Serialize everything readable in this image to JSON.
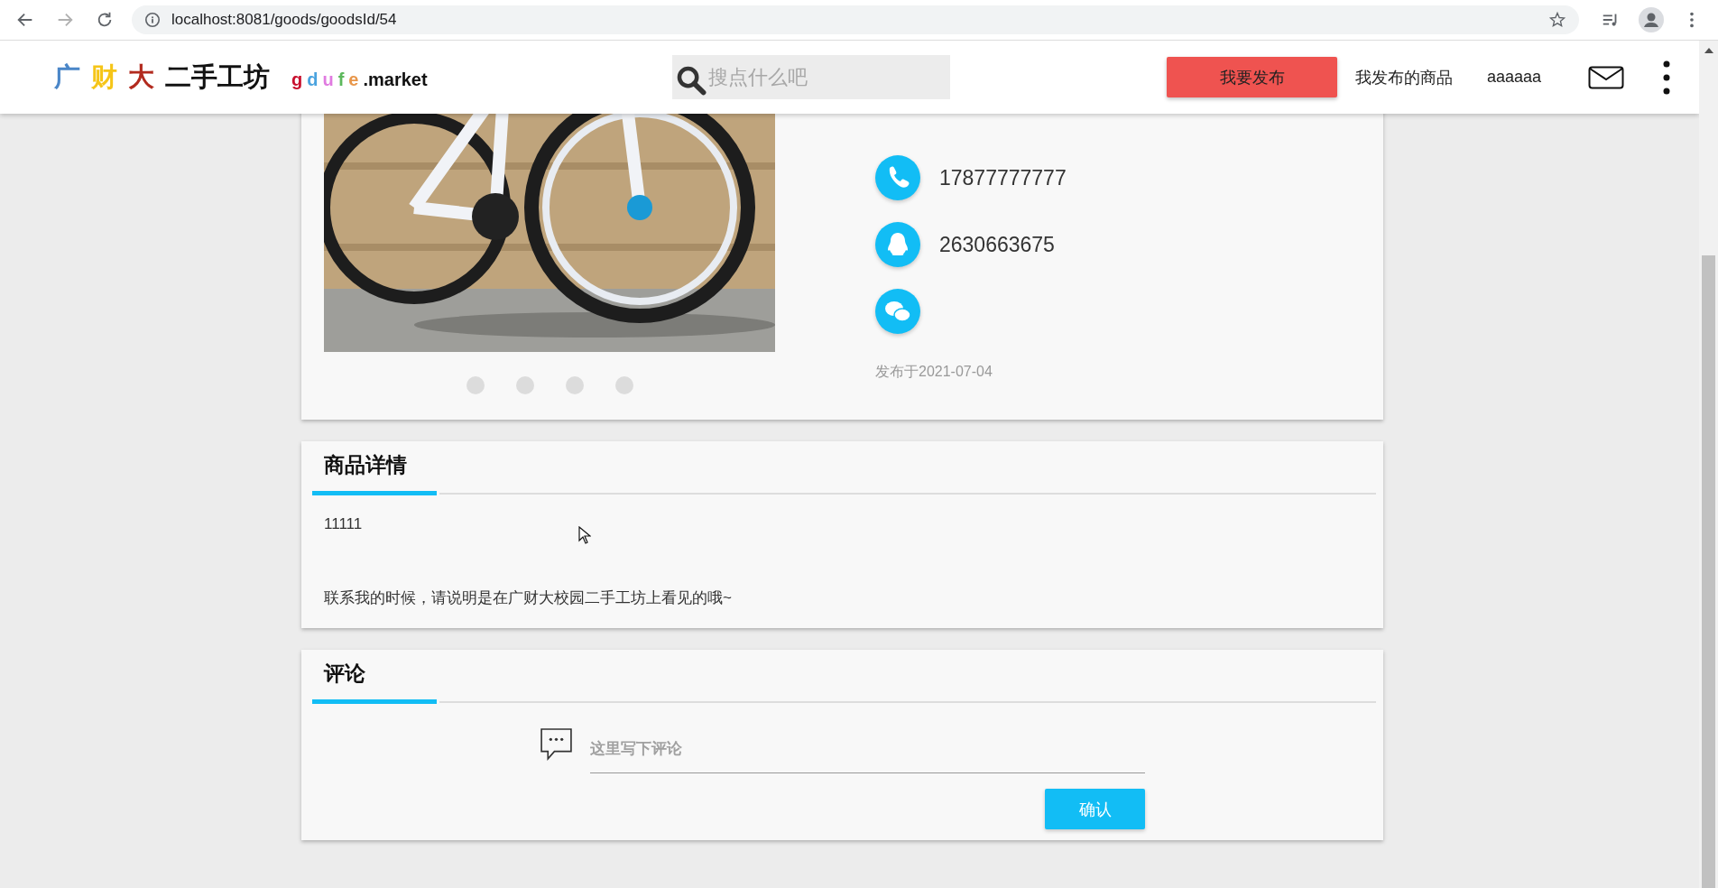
{
  "browser": {
    "nav": [
      {
        "kind": "back",
        "disabled": false
      },
      {
        "kind": "forward",
        "disabled": true
      },
      {
        "kind": "reload",
        "disabled": false
      }
    ],
    "url": "localhost:8081/goods/goodsId/54"
  },
  "header": {
    "logo": [
      {
        "text": "广",
        "color": "#4a86c8"
      },
      {
        "text": "财",
        "color": "#f5c518"
      },
      {
        "text": "大",
        "color": "#b22a1e"
      },
      {
        "text": "二手工坊",
        "color": "#111111"
      }
    ],
    "sublogo": [
      {
        "text": "g",
        "color": "#c8102e"
      },
      {
        "text": "d",
        "color": "#4aa3df"
      },
      {
        "text": "u",
        "color": "#e07be0"
      },
      {
        "text": "f",
        "color": "#5cb85c"
      },
      {
        "text": "e",
        "color": "#e8964a"
      }
    ],
    "sublogo_suffix": ".market",
    "search": {
      "placeholder": "搜点什么吧"
    },
    "publish_button": "我要发布",
    "links": [
      "我发布的商品",
      "aaaaaa"
    ]
  },
  "goods": {
    "carousel_dots": [
      {
        "selected": false
      },
      {
        "selected": false
      },
      {
        "selected": false
      },
      {
        "selected": false
      }
    ],
    "contacts": [
      {
        "kind": "phone",
        "text": "17877777777"
      },
      {
        "kind": "qq",
        "text": "2630663675"
      },
      {
        "kind": "wechat"
      }
    ],
    "published": "发布于2021-07-04"
  },
  "details": {
    "title": "商品详情",
    "description": "11111",
    "notice": "联系我的时候，请说明是在广财大校园二手工坊上看见的哦~"
  },
  "comments": {
    "title": "评论",
    "input": {
      "placeholder": "这里写下评论"
    },
    "submit": "确认"
  }
}
